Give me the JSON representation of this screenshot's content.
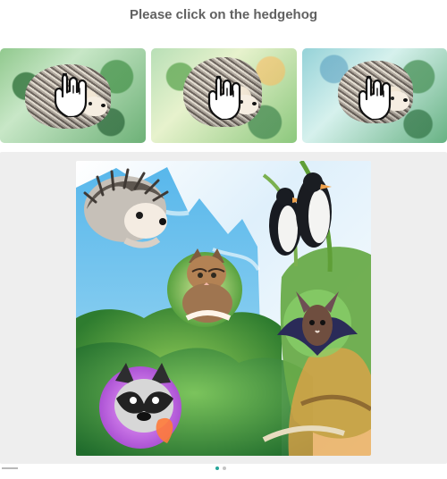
{
  "prompt": {
    "title": "Please click on the hedgehog"
  },
  "examples": {
    "items": [
      {
        "name": "hedgehog-example-1",
        "subject": "hedgehog",
        "cursor_icon": "hand-pointer-icon"
      },
      {
        "name": "hedgehog-example-2",
        "subject": "hedgehog",
        "cursor_icon": "hand-pointer-icon"
      },
      {
        "name": "hedgehog-example-3",
        "subject": "hedgehog",
        "cursor_icon": "hand-pointer-icon"
      }
    ]
  },
  "challenge": {
    "animals": [
      "hedgehog",
      "cat",
      "penguin",
      "bat",
      "raccoon"
    ]
  },
  "colors": {
    "page_background": "#ffffff",
    "panel_background": "#eeeeee",
    "title_text": "#616161",
    "accent_teal": "#26a69a"
  }
}
